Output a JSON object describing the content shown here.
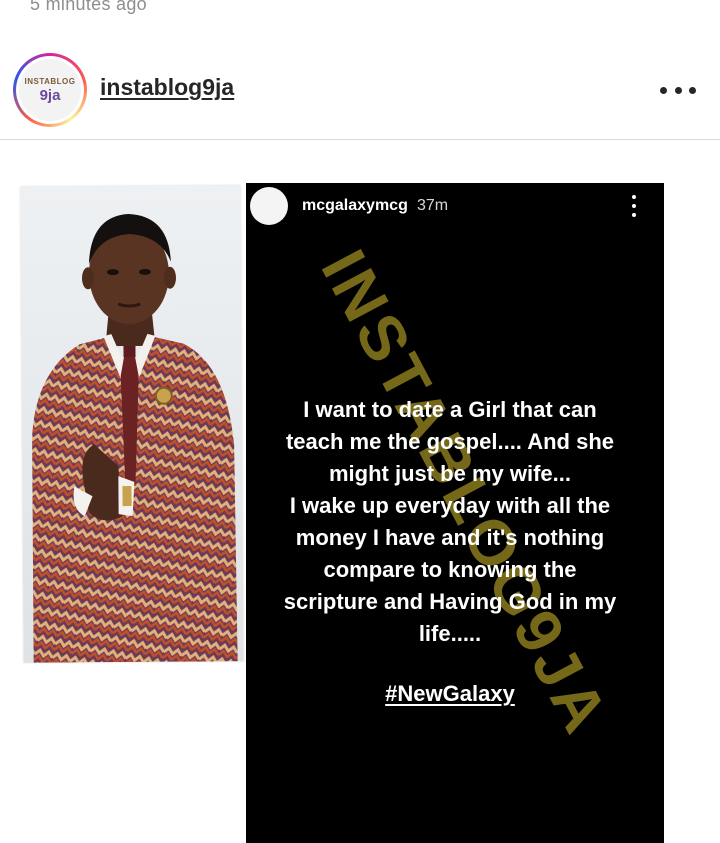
{
  "post": {
    "timestamp": "5 minutes ago",
    "username": "instablog9ja",
    "avatar_logo_top": "INSTABLOG",
    "avatar_logo_bottom": "9ja",
    "more_icon": "more-horizontal-icon"
  },
  "story": {
    "username": "mcgalaxymcg",
    "time": "37m",
    "more_icon": "more-vertical-icon",
    "text": "I want to date a Girl that can\nteach me the gospel.... And she\nmight just be my wife...\nI wake up everyday with all the\nmoney I have and it's nothing\ncompare to knowing the\nscripture and Having God in my\nlife.....",
    "hashtag": "#NewGalaxy",
    "watermark": "INSTABLOG9JA",
    "watermark_color": "#8a7a1c"
  },
  "photo": {
    "description_icon": "person-photo",
    "suit_colors": [
      "#b5552a",
      "#5a3f6e",
      "#d9b48a",
      "#8f3b2c"
    ]
  }
}
